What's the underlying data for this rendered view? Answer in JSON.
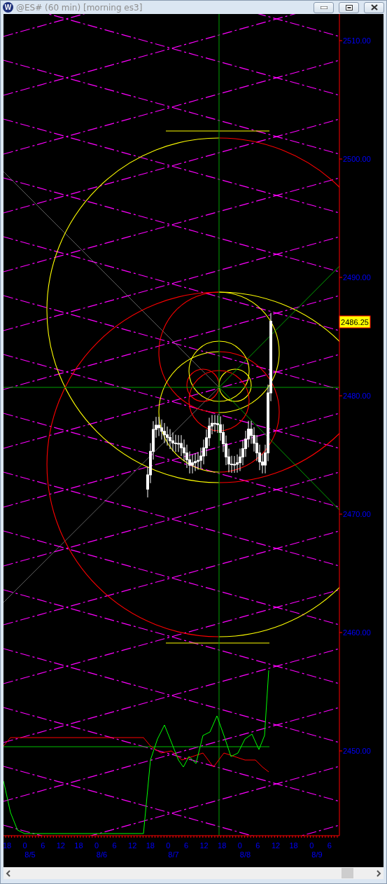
{
  "window": {
    "logo_letter": "W",
    "title": "@ES# (60 min) [morning es3]"
  },
  "y_axis": {
    "labels": [
      "2510.00",
      "2500.00",
      "2490.00",
      "2480.00",
      "2470.00",
      "2460.00",
      "2450.00"
    ]
  },
  "price_tag": "2486.25",
  "x_axis": {
    "hours": [
      "18",
      "0",
      "6",
      "12",
      "18",
      "0",
      "6",
      "12",
      "18",
      "0",
      "6",
      "12",
      "18",
      "0",
      "6",
      "12",
      "18",
      "0",
      "6"
    ],
    "dates": [
      "8/5",
      "8/6",
      "8/7",
      "8/8",
      "8/9"
    ]
  }
}
